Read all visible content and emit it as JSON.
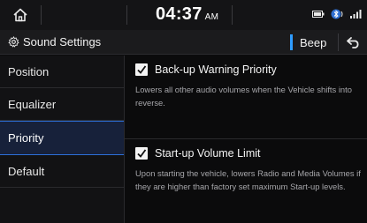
{
  "status_bar": {
    "time": "04:37",
    "ampm": "AM"
  },
  "header": {
    "title": "Sound Settings",
    "beep_label": "Beep"
  },
  "sidebar": {
    "items": [
      {
        "label": "Position",
        "active": false
      },
      {
        "label": "Equalizer",
        "active": false
      },
      {
        "label": "Priority",
        "active": true
      },
      {
        "label": "Default",
        "active": false
      }
    ]
  },
  "options": [
    {
      "title": "Back-up Warning Priority",
      "description": "Lowers all other audio volumes when the Vehicle shifts into reverse.",
      "checked": true
    },
    {
      "title": "Start-up Volume Limit",
      "description": "Upon starting the vehicle, lowers Radio and Media Volumes if they are higher than factory set maximum Start-up levels.",
      "checked": true
    }
  ],
  "colors": {
    "accent": "#2f9cff",
    "active_row": "#17213a",
    "background": "#0b0b0c"
  }
}
